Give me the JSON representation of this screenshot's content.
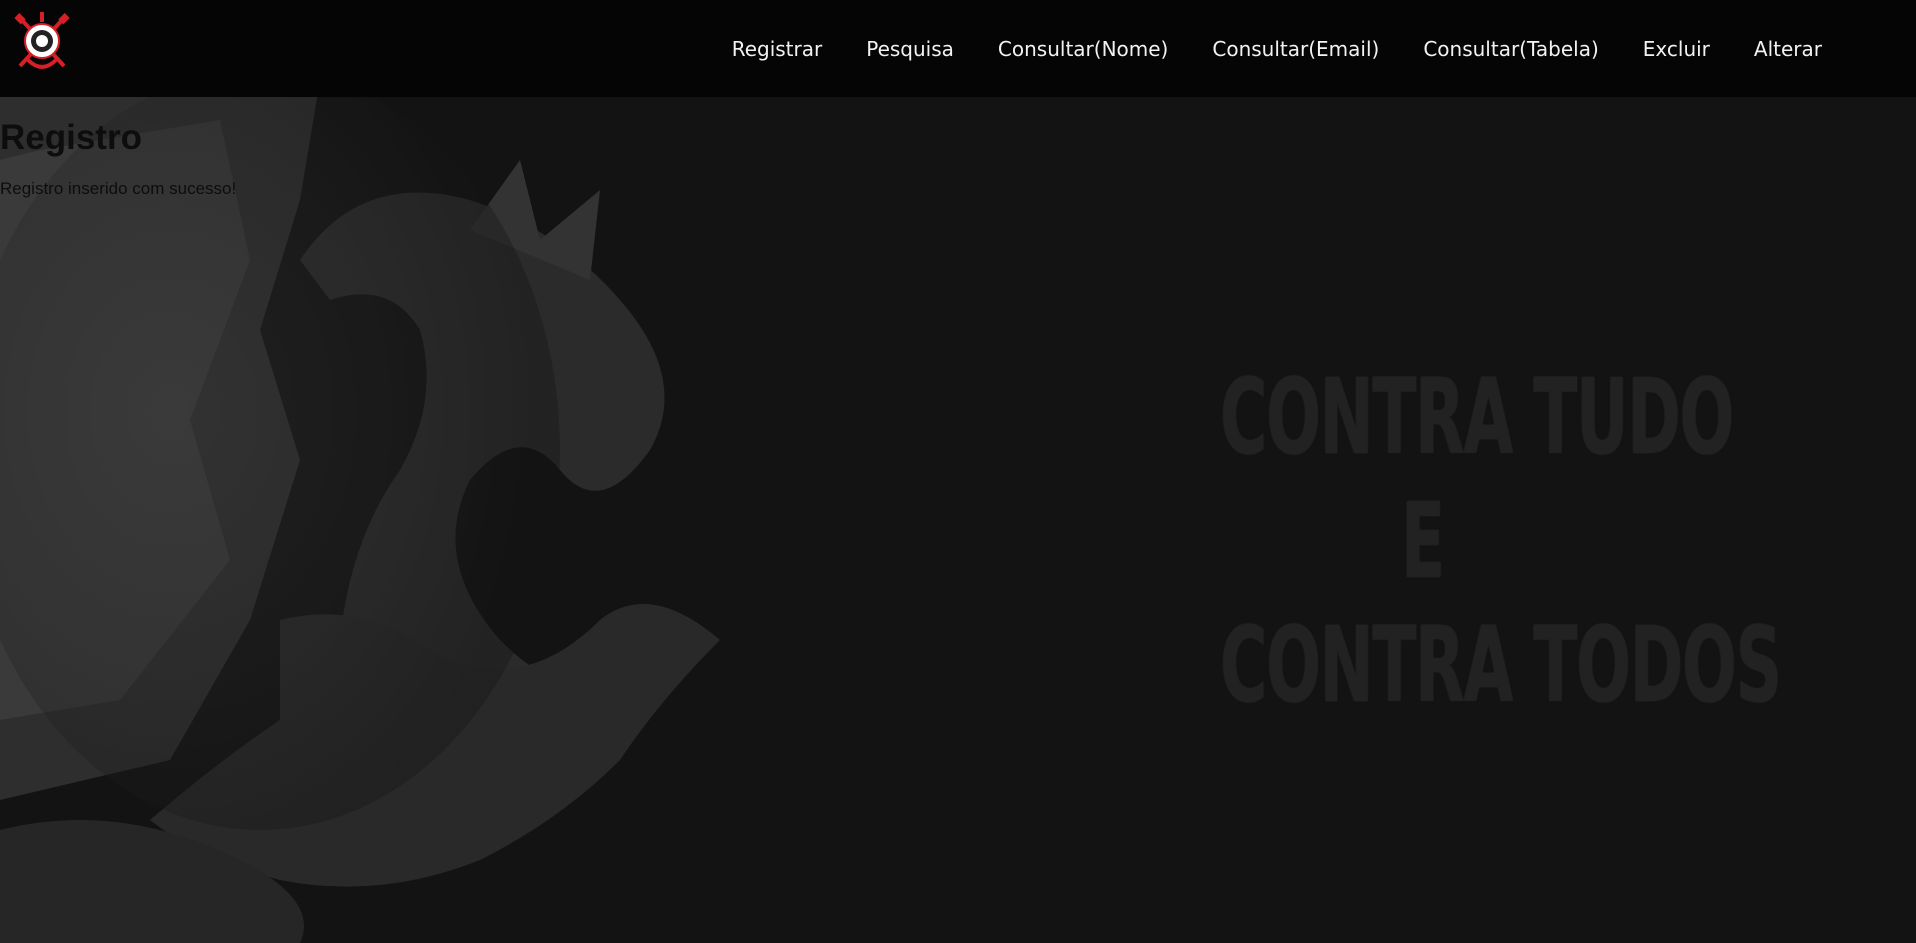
{
  "nav": {
    "logo_alt": "Corinthians",
    "links": [
      {
        "label": "Registrar"
      },
      {
        "label": "Pesquisa"
      },
      {
        "label": "Consultar(Nome)"
      },
      {
        "label": "Consultar(Email)"
      },
      {
        "label": "Consultar(Tabela)"
      },
      {
        "label": "Excluir"
      },
      {
        "label": "Alterar"
      }
    ]
  },
  "main": {
    "title": "Registro",
    "status_message": "Registro inserido com sucesso!"
  },
  "slogan": {
    "line1": "CONTRA TUDO",
    "line2": "E",
    "line3": "CONTRA TODOS"
  },
  "colors": {
    "navbar_bg": "#050505",
    "page_bg": "#131313",
    "nav_text": "#f2f2f2",
    "logo_red": "#d81f26"
  }
}
